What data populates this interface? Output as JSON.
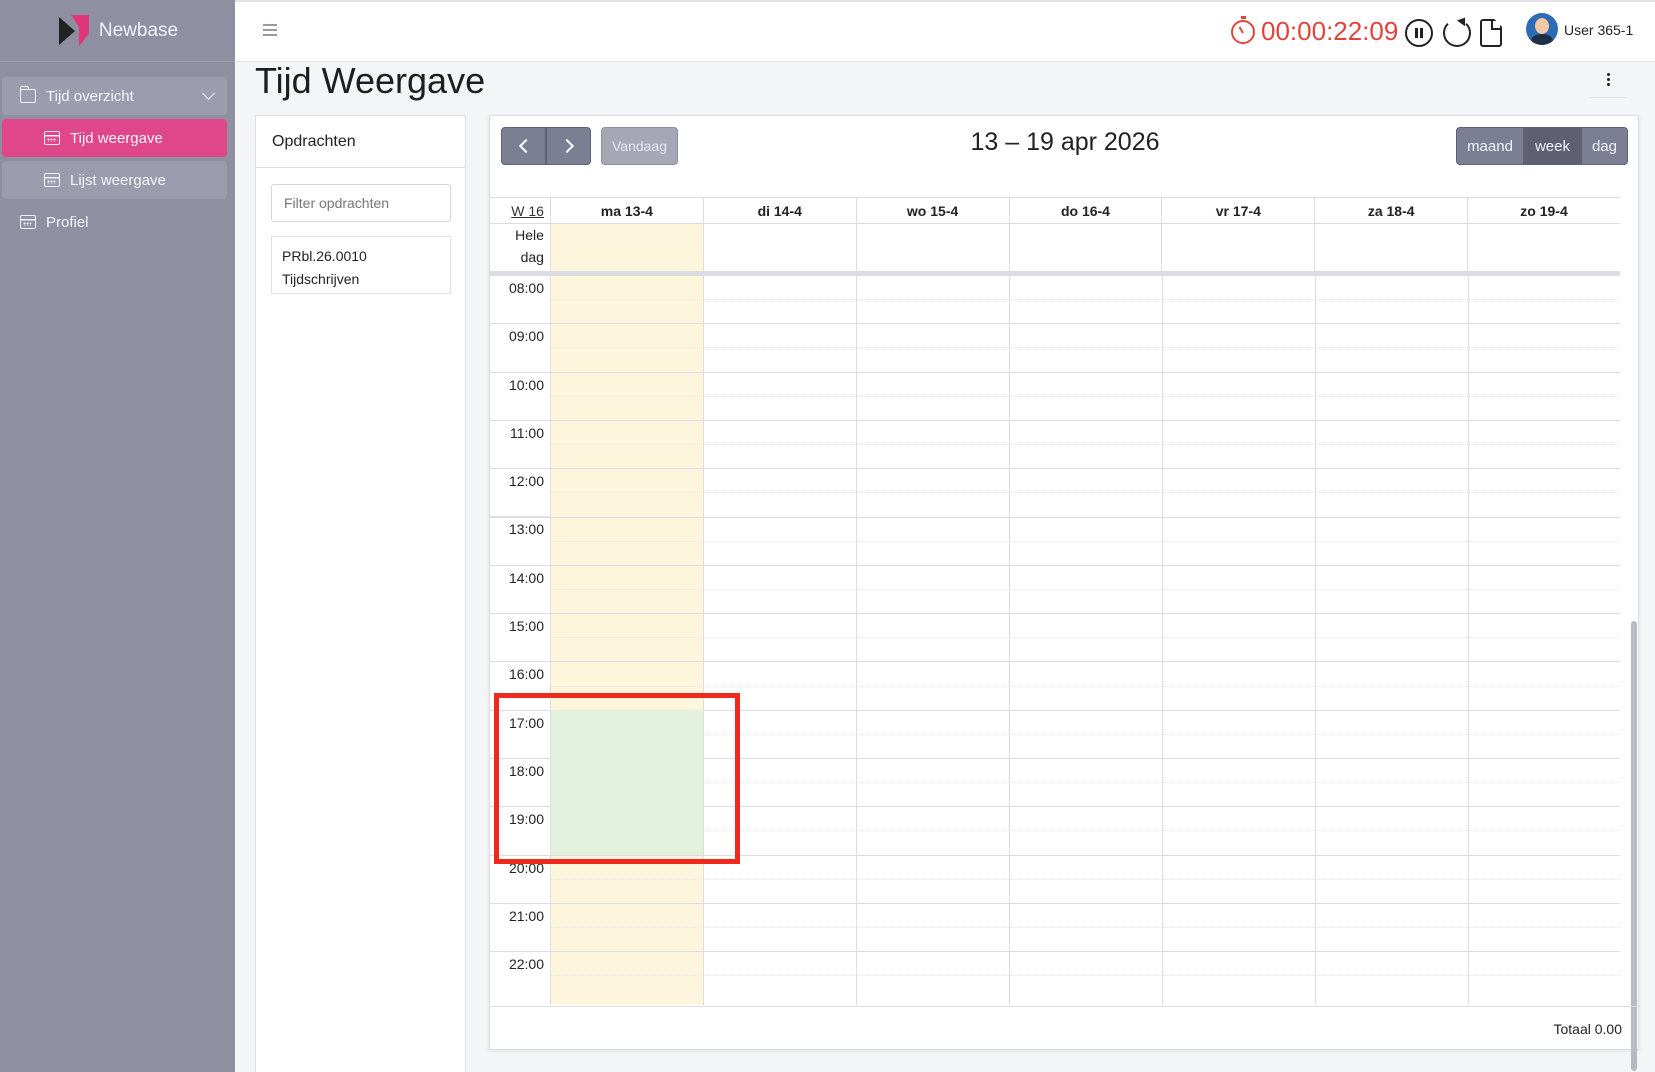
{
  "app": {
    "name": "Newbase",
    "logo_colors": {
      "dark": "#222222",
      "accent": "#e0357a"
    }
  },
  "sidebar": {
    "items": [
      {
        "label": "Tijd overzicht",
        "icon": "folder-icon",
        "expanded": true
      },
      {
        "label": "Tijd weergave",
        "icon": "calendar-icon",
        "active": true
      },
      {
        "label": "Lijst weergave",
        "icon": "calendar-icon"
      },
      {
        "label": "Profiel",
        "icon": "calendar-icon"
      }
    ]
  },
  "header": {
    "timer": "00:00:22:09",
    "timer_color": "#e0453c",
    "user": "User 365-1"
  },
  "page": {
    "title": "Tijd Weergave"
  },
  "opdrachten": {
    "title": "Opdrachten",
    "filter_placeholder": "Filter opdrachten",
    "items": [
      {
        "code": "PRbl.26.0010",
        "name": "Tijdschrijven"
      }
    ]
  },
  "calendar": {
    "range": "13 – 19 apr 2026",
    "today_label": "Vandaag",
    "views": [
      "maand",
      "week",
      "dag"
    ],
    "active_view": "week",
    "week_label": "W 16",
    "allday_label_1": "Hele",
    "allday_label_2": "dag",
    "days": [
      "ma 13-4",
      "di 14-4",
      "wo 15-4",
      "do 16-4",
      "vr 17-4",
      "za 18-4",
      "zo 19-4"
    ],
    "today_index": 0,
    "hours": [
      "08:00",
      "09:00",
      "10:00",
      "11:00",
      "12:00",
      "13:00",
      "14:00",
      "15:00",
      "16:00",
      "17:00",
      "18:00",
      "19:00",
      "20:00",
      "21:00",
      "22:00"
    ],
    "selection": {
      "day": "ma 13-4",
      "start": "17:00",
      "end": "20:00"
    },
    "colors": {
      "today": "#fdf6dc",
      "selection": "#e3f1dc",
      "highlight": "#ef2a1c"
    },
    "total": "Totaal 0.00"
  }
}
